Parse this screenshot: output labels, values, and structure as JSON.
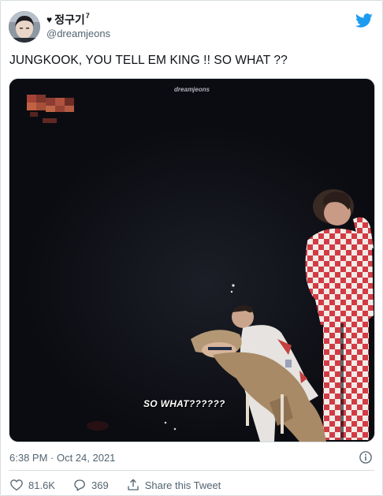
{
  "author": {
    "heart": "♥",
    "display_name": "정구기",
    "display_name_sup": "7",
    "handle": "@dreamjeons"
  },
  "tweet": {
    "text": "JUNGKOOK, YOU TELL EM KING !! SO WHAT ??"
  },
  "media": {
    "watermark": "dreamjeons",
    "subtitle": "SO WHAT??????"
  },
  "meta": {
    "timestamp": "6:38 PM · Oct 24, 2021"
  },
  "actions": {
    "like_count": "81.6K",
    "reply_count": "369",
    "share_label": "Share this Tweet"
  },
  "colors": {
    "twitter_blue": "#1d9bf0",
    "text_secondary": "#536471",
    "divider": "#d7dde1"
  },
  "icons": [
    "twitter-bird-icon",
    "info-icon",
    "heart-icon",
    "reply-icon",
    "share-icon"
  ]
}
